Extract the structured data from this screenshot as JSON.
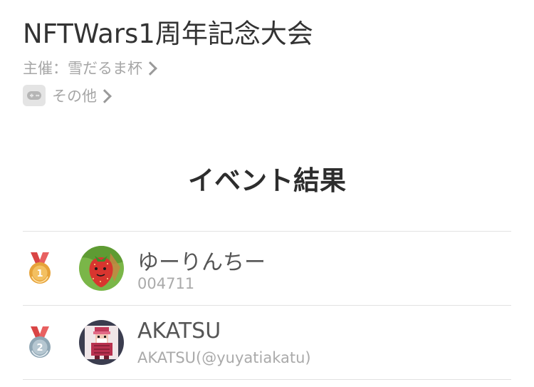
{
  "event": {
    "title": "NFTWars1周年記念大会",
    "organizer": "主催：雪だるま杯",
    "category": "その他",
    "category_icon": "gamepad-icon"
  },
  "results": {
    "heading": "イベント結果",
    "entries": [
      {
        "rank": "1",
        "medal": "gold-medal-icon",
        "medal_color": "#e6a33a",
        "name": "ゆーりんちー",
        "sub": "004711",
        "avatar": "strawberry-avatar"
      },
      {
        "rank": "2",
        "medal": "silver-medal-icon",
        "medal_color": "#9fb3c0",
        "name": "AKATSU",
        "sub": "AKATSU(@yuyatiakatu)",
        "avatar": "pixel-character-avatar"
      }
    ]
  },
  "colors": {
    "ribbon": "#e04848",
    "divider": "#e2e2e2"
  }
}
